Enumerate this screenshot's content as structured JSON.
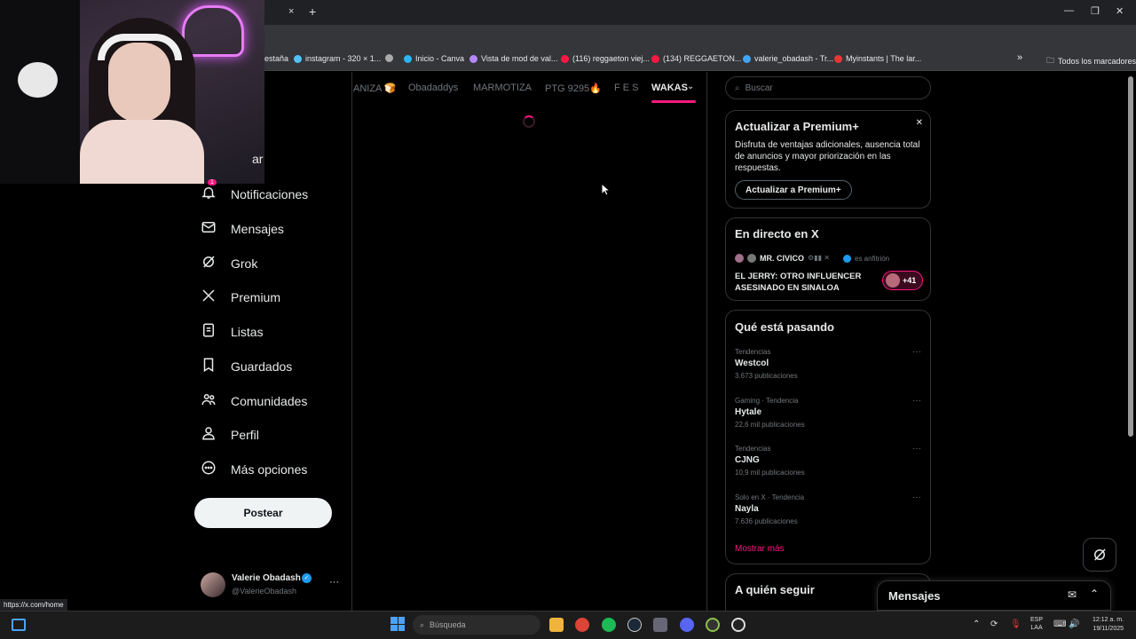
{
  "browser": {
    "close_tab": "×",
    "new_tab": "+",
    "window": {
      "min": "—",
      "max": "❐",
      "close": "✕"
    },
    "bookmarks": [
      {
        "label": "estaña",
        "color": "#888"
      },
      {
        "label": "instagram - 320 × 1...",
        "color": "#4fc3f7"
      },
      {
        "label": "",
        "color": "#aaa"
      },
      {
        "label": "Inicio - Canva",
        "color": "#29b6f6"
      },
      {
        "label": "Vista de mod de val...",
        "color": "#b388ff"
      },
      {
        "label": "(116) reggaeton viej...",
        "color": "#ff1744"
      },
      {
        "label": "(134) REGGAETON...",
        "color": "#ff1744"
      },
      {
        "label": "valerie_obadash - Tr...",
        "color": "#42a5f5"
      },
      {
        "label": "Myinstants | The lar...",
        "color": "#e53935"
      }
    ],
    "bookmarks_overflow": "»",
    "all_bookmarks": "Todos los marcadores",
    "status_url": "https://x.com/home"
  },
  "sidebar": {
    "partial_label": "ar",
    "items": [
      {
        "label": "Notificaciones",
        "icon": "bell-icon",
        "badge": "1"
      },
      {
        "label": "Mensajes",
        "icon": "mail-icon"
      },
      {
        "label": "Grok",
        "icon": "grok-icon"
      },
      {
        "label": "Premium",
        "icon": "x-logo-icon"
      },
      {
        "label": "Listas",
        "icon": "list-icon"
      },
      {
        "label": "Guardados",
        "icon": "bookmark-icon"
      },
      {
        "label": "Comunidades",
        "icon": "communities-icon"
      },
      {
        "label": "Perfil",
        "icon": "person-icon"
      },
      {
        "label": "Más opciones",
        "icon": "more-circle-icon"
      }
    ],
    "post_button": "Postear",
    "account": {
      "name": "Valerie Obadash",
      "handle": "@ValerieObadash",
      "more": "···"
    }
  },
  "tabs": [
    {
      "label": "ANIZA 🍞",
      "active": false
    },
    {
      "label": "Obadaddys",
      "active": false
    },
    {
      "label": "MARMOTIZA",
      "active": false
    },
    {
      "label": "PTG 9295🔥",
      "active": false
    },
    {
      "label": "F E S",
      "active": false
    },
    {
      "label": "WAKAS",
      "active": true
    }
  ],
  "search": {
    "placeholder": "Buscar"
  },
  "premium_card": {
    "title": "Actualizar a Premium+",
    "body": "Disfruta de ventajas adicionales, ausencia total de anuncios y mayor priorización en las respuestas.",
    "button": "Actualizar a Premium+",
    "close": "✕"
  },
  "live_card": {
    "title": "En directo en X",
    "host": "MR. CIVICO",
    "host_suffix": "es anfitrión",
    "headline": "EL JERRY: OTRO INFLUENCER ASESINADO EN SINALOA",
    "listeners": "+41"
  },
  "trends_card": {
    "title": "Qué está pasando",
    "items": [
      {
        "category": "Tendencias",
        "name": "Westcol",
        "count": "3.673 publicaciones"
      },
      {
        "category": "Gaming · Tendencia",
        "name": "Hytale",
        "count": "22,6 mil publicaciones"
      },
      {
        "category": "Tendencias",
        "name": "CJNG",
        "count": "10,9 mil publicaciones"
      },
      {
        "category": "Solo en X · Tendencia",
        "name": "Nayla",
        "count": "7.636 publicaciones"
      }
    ],
    "show_more": "Mostrar más",
    "more": "···"
  },
  "who_to_follow": {
    "title": "A quién seguir"
  },
  "messages_dock": {
    "title": "Mensajes"
  },
  "taskbar": {
    "search_placeholder": "Búsqueda",
    "lang": "ESP",
    "lang2": "LAA",
    "time": "12:12 a. m.",
    "date": "19/11/2025"
  },
  "colors": {
    "accent": "#f91880",
    "verified": "#1d9bf0",
    "bg": "#000000"
  }
}
